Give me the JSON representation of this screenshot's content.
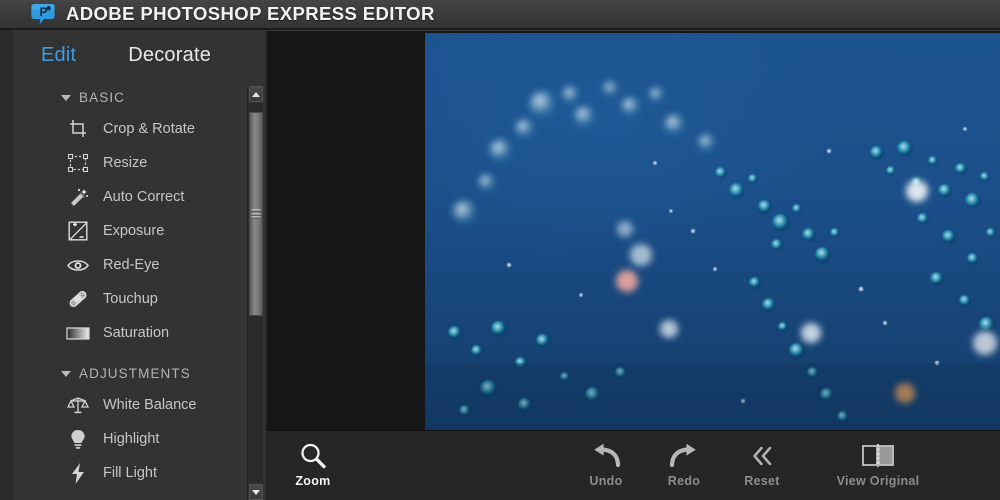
{
  "app": {
    "title": "ADOBE PHOTOSHOP EXPRESS EDITOR",
    "logo_icon": "photoshop-express-bubble-logo",
    "header_bg": "#3c3c3c",
    "accent": "#3f9ae0"
  },
  "sidebar": {
    "tabs": [
      {
        "label": "Edit",
        "active": true,
        "color": "#3f9ae0"
      },
      {
        "label": "Decorate",
        "active": false,
        "color": "#e8e8e8"
      }
    ],
    "sections": [
      {
        "label": "BASIC",
        "expanded": true,
        "items": [
          {
            "label": "Crop & Rotate",
            "icon": "crop-icon"
          },
          {
            "label": "Resize",
            "icon": "resize-icon"
          },
          {
            "label": "Auto Correct",
            "icon": "magic-wand-icon"
          },
          {
            "label": "Exposure",
            "icon": "exposure-icon"
          },
          {
            "label": "Red-Eye",
            "icon": "eye-icon"
          },
          {
            "label": "Touchup",
            "icon": "bandage-icon"
          },
          {
            "label": "Saturation",
            "icon": "saturation-gradient-icon"
          }
        ]
      },
      {
        "label": "ADJUSTMENTS",
        "expanded": true,
        "items": [
          {
            "label": "White Balance",
            "icon": "scales-icon"
          },
          {
            "label": "Highlight",
            "icon": "lightbulb-icon"
          },
          {
            "label": "Fill Light",
            "icon": "lightning-bolt-icon"
          }
        ]
      }
    ],
    "scrollbar": {
      "up_arrow_icon": "scroll-up-arrow-icon",
      "down_arrow_icon": "scroll-down-arrow-icon",
      "grip_icon": "scrollbar-grip-icon"
    }
  },
  "canvas": {
    "background": "#171717",
    "image": {
      "description": "Underwater blue photo with white and teal water droplets / bubbles",
      "base_color": "#1b5490"
    }
  },
  "toolbar": {
    "buttons": [
      {
        "label": "Zoom",
        "icon": "magnifier-icon",
        "active": true
      },
      {
        "label": "Undo",
        "icon": "undo-arrow-icon",
        "active": false
      },
      {
        "label": "Redo",
        "icon": "redo-arrow-icon",
        "active": false
      },
      {
        "label": "Reset",
        "icon": "double-chevron-left-icon",
        "active": false
      },
      {
        "label": "View Original",
        "icon": "split-view-icon",
        "active": false
      }
    ]
  }
}
